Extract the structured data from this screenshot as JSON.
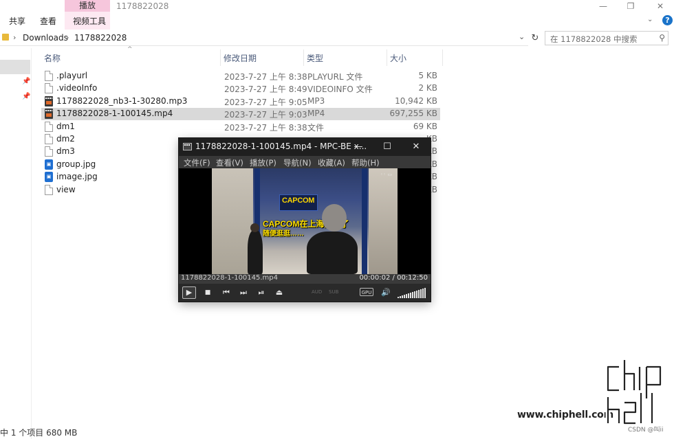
{
  "ribbon": {
    "tabs": [
      "共享",
      "查看",
      "视频工具"
    ],
    "context_header": "播放",
    "window_title": "1178822028"
  },
  "window_controls": {
    "minimize": "—",
    "maximize": "❐",
    "close": "✕"
  },
  "address": {
    "crumbs": [
      "Downloads",
      "1178822028"
    ],
    "search_placeholder": "在 1178822028 中搜索"
  },
  "columns": [
    "名称",
    "修改日期",
    "类型",
    "大小"
  ],
  "files": [
    {
      "name": ".playurl",
      "date": "2023-7-27 上午 8:38",
      "type": "PLAYURL 文件",
      "size": "5 KB",
      "icon": "document-icon"
    },
    {
      "name": ".videoInfo",
      "date": "2023-7-27 上午 8:49",
      "type": "VIDEOINFO 文件",
      "size": "2 KB",
      "icon": "document-icon"
    },
    {
      "name": "1178822028_nb3-1-30280.mp3",
      "date": "2023-7-27 上午 9:05",
      "type": "MP3",
      "size": "10,942 KB",
      "icon": "media-file-icon"
    },
    {
      "name": "1178822028-1-100145.mp4",
      "date": "2023-7-27 上午 9:03",
      "type": "MP4",
      "size": "697,255 KB",
      "icon": "media-file-icon",
      "selected": true
    },
    {
      "name": "dm1",
      "date": "2023-7-27 上午 8:38",
      "type": "文件",
      "size": "69 KB",
      "icon": "document-icon"
    },
    {
      "name": "dm2",
      "size": "KB",
      "icon": "document-icon"
    },
    {
      "name": "dm3",
      "size": "KB",
      "icon": "document-icon"
    },
    {
      "name": "group.jpg",
      "size": "KB",
      "icon": "image-file-icon"
    },
    {
      "name": "image.jpg",
      "size": "KB",
      "icon": "image-file-icon"
    },
    {
      "name": "view",
      "size": "KB",
      "icon": "document-icon"
    }
  ],
  "status": "中 1 个项目  680 MB",
  "player": {
    "title": "1178822028-1-100145.mp4 - MPC-BE x...",
    "menu": [
      "文件(F)",
      "查看(V)",
      "播放(P)",
      "导航(N)",
      "收藏(A)",
      "帮助(H)"
    ],
    "filename": "1178822028-1-100145.mp4",
    "time": "00:00:02 / 00:12:50",
    "video_sign": "CAPCOM",
    "video_caption_1": "CAPCOM在上海开店了",
    "video_caption_2": "随便逛逛……",
    "labels": {
      "aud": "AUD",
      "sub": "SUB",
      "gpu": "GPU"
    },
    "volume": 1.0
  },
  "watermark": {
    "url": "www.chiphell.com",
    "csdn": "CSDN @叫ii"
  }
}
